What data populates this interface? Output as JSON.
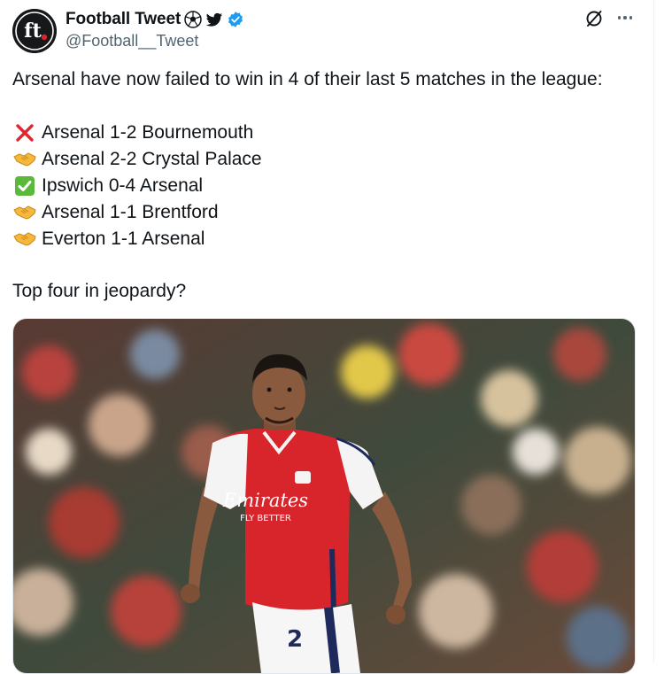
{
  "author": {
    "display_name": "Football Tweet",
    "handle": "@Football__Tweet",
    "avatar_initials": "ft",
    "badges": [
      "soccer-ball-icon",
      "bird-icon",
      "verified-badge-icon"
    ]
  },
  "actions": {
    "grok_icon": "grok-icon",
    "more_icon": "more-options-icon"
  },
  "tweet": {
    "intro": "Arsenal have now failed to win in 4 of their last 5 matches in the league:",
    "results": [
      {
        "icon": "cross-mark-icon",
        "text": "Arsenal 1-2 Bournemouth"
      },
      {
        "icon": "handshake-icon",
        "text": "Arsenal 2-2 Crystal Palace"
      },
      {
        "icon": "check-mark-icon",
        "text": "Ipswich 0-4 Arsenal"
      },
      {
        "icon": "handshake-icon",
        "text": "Arsenal 1-1 Brentford"
      },
      {
        "icon": "handshake-icon",
        "text": "Everton 1-1 Arsenal"
      }
    ],
    "question": "Top four in jeopardy?"
  },
  "photo": {
    "shirt_sponsor_line1": "Emirates",
    "shirt_sponsor_line2": "FLY BETTER",
    "shirt_number": "2",
    "colors": {
      "shirt_red": "#d8252c",
      "shirt_white": "#f4f4f4",
      "shorts_white": "#f6f6f6",
      "navy": "#1f2a5c"
    }
  }
}
